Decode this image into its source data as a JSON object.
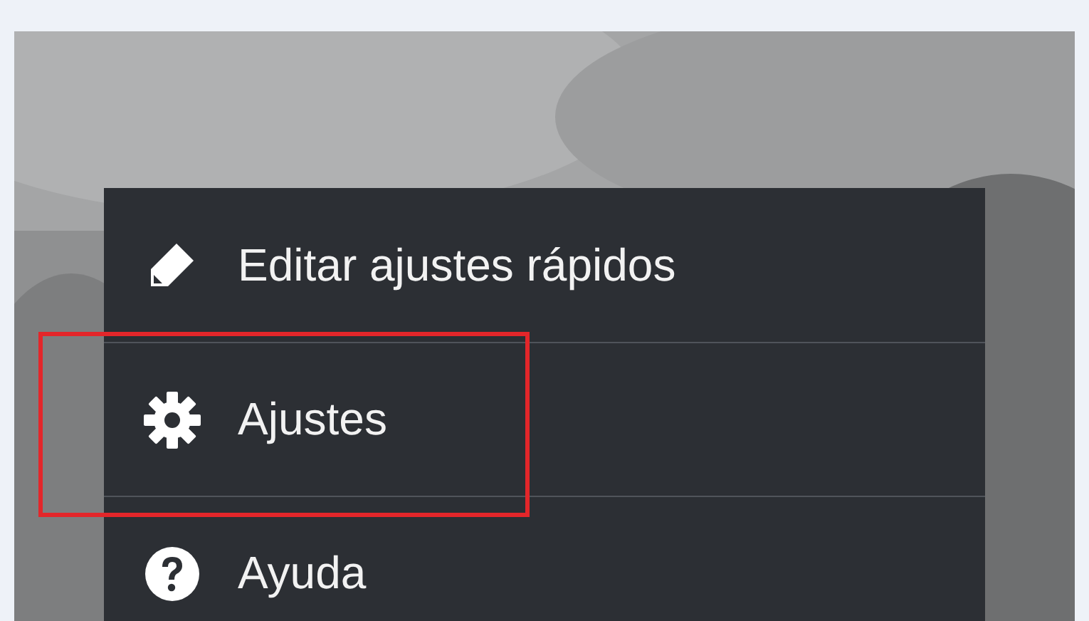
{
  "menu": {
    "items": [
      {
        "kind": "edit",
        "label": "Editar ajustes rápidos",
        "highlighted": false
      },
      {
        "kind": "settings",
        "label": "Ajustes",
        "highlighted": true
      },
      {
        "kind": "help",
        "label": "Ayuda",
        "highlighted": false
      }
    ]
  }
}
